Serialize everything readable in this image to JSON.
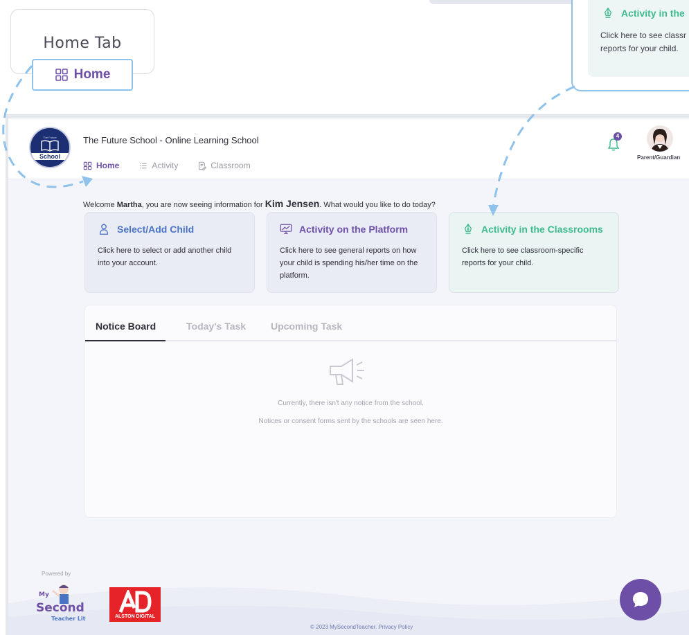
{
  "callouts": {
    "home_tab_title": "Home Tab",
    "home_pill_label": "Home",
    "activity_title": "Activity in the",
    "activity_desc_line1": "Click here to see classr",
    "activity_desc_line2": "reports for your child."
  },
  "header": {
    "school_logo_text": "School",
    "school_logo_small": "The Future",
    "school_name": "The Future School - Online Learning School",
    "nav": [
      {
        "label": "Home",
        "icon": "grid-icon",
        "active": true
      },
      {
        "label": "Activity",
        "icon": "list-icon",
        "active": false
      },
      {
        "label": "Classroom",
        "icon": "document-edit-icon",
        "active": false
      }
    ],
    "notification_count": "4",
    "role": "Parent/Guardian"
  },
  "welcome": {
    "prefix": "Welcome ",
    "parent": "Martha",
    "middle": ", you are now seeing information for ",
    "child": "Kim Jensen",
    "suffix": ". What would you like to do today?"
  },
  "cards": [
    {
      "title": "Select/Add Child",
      "desc": "Click here to select or add another child into your account.",
      "icon": "child-user-icon",
      "color": "#4a73c4"
    },
    {
      "title": "Activity on the Platform",
      "desc": "Click here to see general reports on how your child is spending his/her time on the platform.",
      "icon": "monitor-chart-icon",
      "color": "#6d4fa8"
    },
    {
      "title": "Activity in the Classrooms",
      "desc": "Click here to see classroom-specific reports for your child.",
      "icon": "pen-nib-icon",
      "color": "#3fb98e"
    }
  ],
  "notice_board": {
    "tabs": [
      "Notice Board",
      "Today's Task",
      "Upcoming Task"
    ],
    "empty_line1": "Currently, there isn't any notice from the school.",
    "empty_line2": "Notices or consent forms sent by the schools are seen here."
  },
  "footer": {
    "powered_by": "Powered by",
    "mst_logo_line1": "My",
    "mst_logo_line2": "Second",
    "mst_logo_line3": "Teacher Lite",
    "ad_logo_text": "ALSTON DIGITAL",
    "copyright": "© 2023 MySecondTeacher. Privacy Policy"
  },
  "colors": {
    "brand_purple": "#6d4fa8",
    "callout_blue": "#8ec2ea",
    "green": "#3fb98e"
  }
}
